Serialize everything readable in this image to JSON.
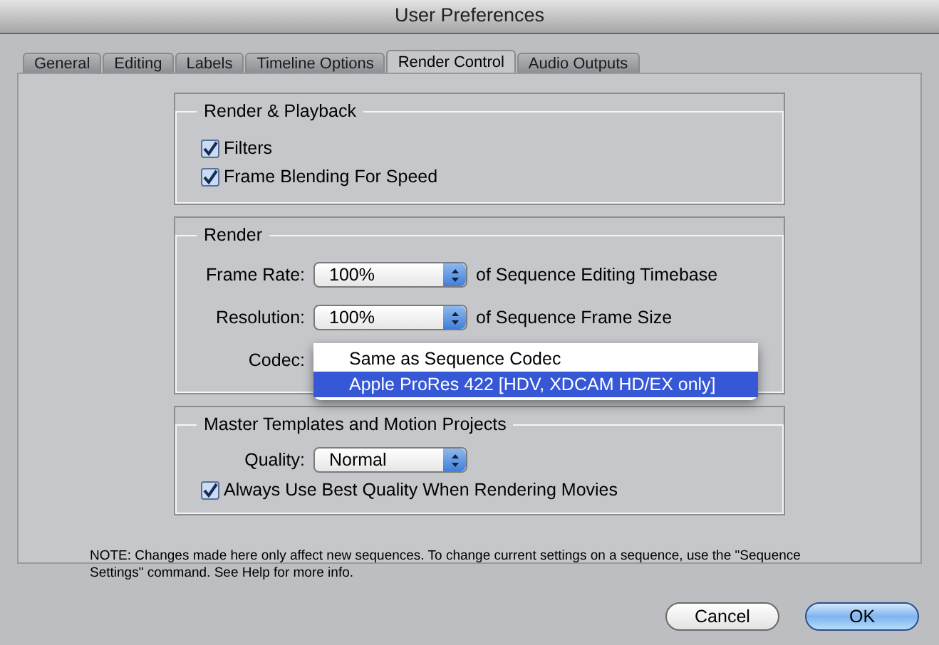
{
  "window": {
    "title": "User Preferences"
  },
  "tabs": [
    {
      "label": "General",
      "selected": false
    },
    {
      "label": "Editing",
      "selected": false
    },
    {
      "label": "Labels",
      "selected": false
    },
    {
      "label": "Timeline Options",
      "selected": false
    },
    {
      "label": "Render Control",
      "selected": true
    },
    {
      "label": "Audio Outputs",
      "selected": false
    }
  ],
  "render_playback": {
    "title": "Render & Playback",
    "options": [
      {
        "label": "Filters",
        "checked": true
      },
      {
        "label": "Frame Blending For Speed",
        "checked": true
      }
    ]
  },
  "render": {
    "title": "Render",
    "rows": [
      {
        "label": "Frame Rate:",
        "value": "100%",
        "suffix": "of Sequence Editing Timebase"
      },
      {
        "label": "Resolution:",
        "value": "100%",
        "suffix": "of Sequence Frame Size"
      },
      {
        "label": "Codec:"
      }
    ],
    "codec_menu": [
      {
        "label": "Same as Sequence Codec",
        "selected": false
      },
      {
        "label": "Apple ProRes 422 [HDV, XDCAM HD/EX only]",
        "selected": true
      }
    ]
  },
  "master_templates": {
    "title": "Master Templates and Motion Projects",
    "quality_label": "Quality:",
    "quality_value": "Normal",
    "options": [
      {
        "label": "Always Use Best Quality When Rendering Movies",
        "checked": true
      }
    ]
  },
  "note": "NOTE: Changes made here only affect new sequences. To change current settings on a sequence, use the \"Sequence Settings\" command. See Help for more info.",
  "buttons": [
    {
      "label": "Cancel",
      "kind": "normal"
    },
    {
      "label": "OK",
      "kind": "default"
    }
  ]
}
